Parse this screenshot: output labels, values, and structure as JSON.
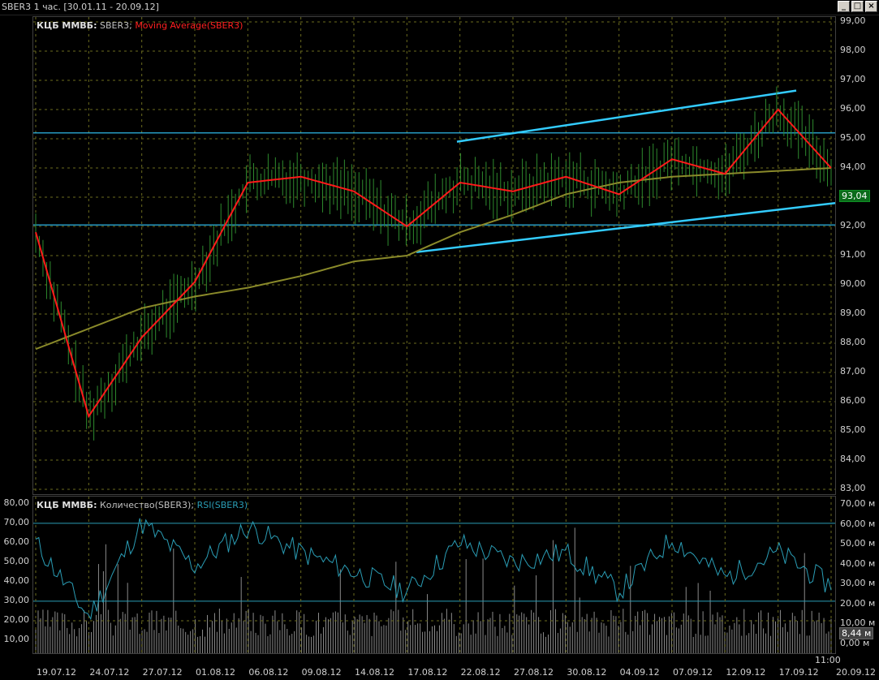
{
  "window": {
    "title": "SBER3  1 час. [30.01.11 - 20.09.12]",
    "buttons": [
      "_",
      "□",
      "×"
    ]
  },
  "price_pane": {
    "source": "КЦБ ММВБ:",
    "symbol": "SBER3;",
    "indicator": "Moving Average(SBER3)",
    "y_ticks": [
      "99,00",
      "98,00",
      "97,00",
      "96,00",
      "95,00",
      "94,00",
      "93,00",
      "92,00",
      "91,00",
      "90,00",
      "89,00",
      "88,00",
      "87,00",
      "86,00",
      "85,00",
      "84,00",
      "83,00"
    ],
    "current_price": "93,04"
  },
  "volume_pane": {
    "source": "КЦБ ММВБ:",
    "series_volume": "Количество(SBER3);",
    "series_rsi": "RSI(SBER3)",
    "left_ticks": [
      "80,00",
      "70,00",
      "60,00",
      "50,00",
      "40,00",
      "30,00",
      "20,00",
      "10,00"
    ],
    "right_ticks": [
      "70,00 м",
      "60,00 м",
      "50,00 м",
      "40,00 м",
      "30,00 м",
      "20,00 м",
      "10,00 м",
      "0,00 м"
    ],
    "current_volume": "8,44 м",
    "time_label": "11:00"
  },
  "x_axis": {
    "labels": [
      "19.07.12",
      "24.07.12",
      "27.07.12",
      "01.08.12",
      "06.08.12",
      "09.08.12",
      "14.08.12",
      "17.08.12",
      "22.08.12",
      "27.08.12",
      "30.08.12",
      "04.09.12",
      "07.09.12",
      "12.09.12",
      "17.09.12",
      "20.09.12"
    ]
  },
  "colors": {
    "background": "#000000",
    "grid": "#6b6b1e",
    "candles": "#2e8b2e",
    "ma_fast": "#ff1a1a",
    "ma_slow": "#8a8a2a",
    "channel": "#33ccff",
    "rsi": "#2a9db5",
    "volume": "#8a8a8a"
  },
  "chart_data": [
    {
      "type": "line",
      "name": "price",
      "ylim": [
        83,
        99
      ],
      "x": [
        "19.07.12",
        "24.07.12",
        "27.07.12",
        "01.08.12",
        "06.08.12",
        "09.08.12",
        "14.08.12",
        "17.08.12",
        "22.08.12",
        "27.08.12",
        "30.08.12",
        "04.09.12",
        "07.09.12",
        "12.09.12",
        "17.09.12",
        "20.09.12"
      ],
      "series": [
        {
          "name": "Moving Average(SBER3)",
          "values": [
            91.8,
            85.5,
            88.2,
            90.1,
            93.5,
            93.7,
            93.2,
            92.0,
            93.5,
            93.2,
            93.7,
            93.1,
            94.3,
            93.8,
            96.0,
            94.0
          ]
        },
        {
          "values": [
            87.8,
            88.5,
            89.2,
            89.6,
            89.9,
            90.3,
            90.8,
            91.0,
            91.8,
            92.4,
            93.1,
            93.5,
            93.7,
            93.8,
            93.9,
            94.0
          ]
        }
      ],
      "close": 93.04
    },
    {
      "type": "line",
      "name": "rsi",
      "ylim": [
        5,
        82
      ],
      "x": [
        "19.07.12",
        "24.07.12",
        "27.07.12",
        "01.08.12",
        "06.08.12",
        "09.08.12",
        "14.08.12",
        "17.08.12",
        "22.08.12",
        "27.08.12",
        "30.08.12",
        "04.09.12",
        "07.09.12",
        "12.09.12",
        "17.09.12",
        "20.09.12"
      ],
      "series": [
        {
          "name": "RSI(SBER3)",
          "values": [
            60,
            22,
            70,
            48,
            68,
            55,
            45,
            35,
            60,
            50,
            55,
            35,
            62,
            42,
            55,
            38
          ]
        }
      ]
    }
  ]
}
